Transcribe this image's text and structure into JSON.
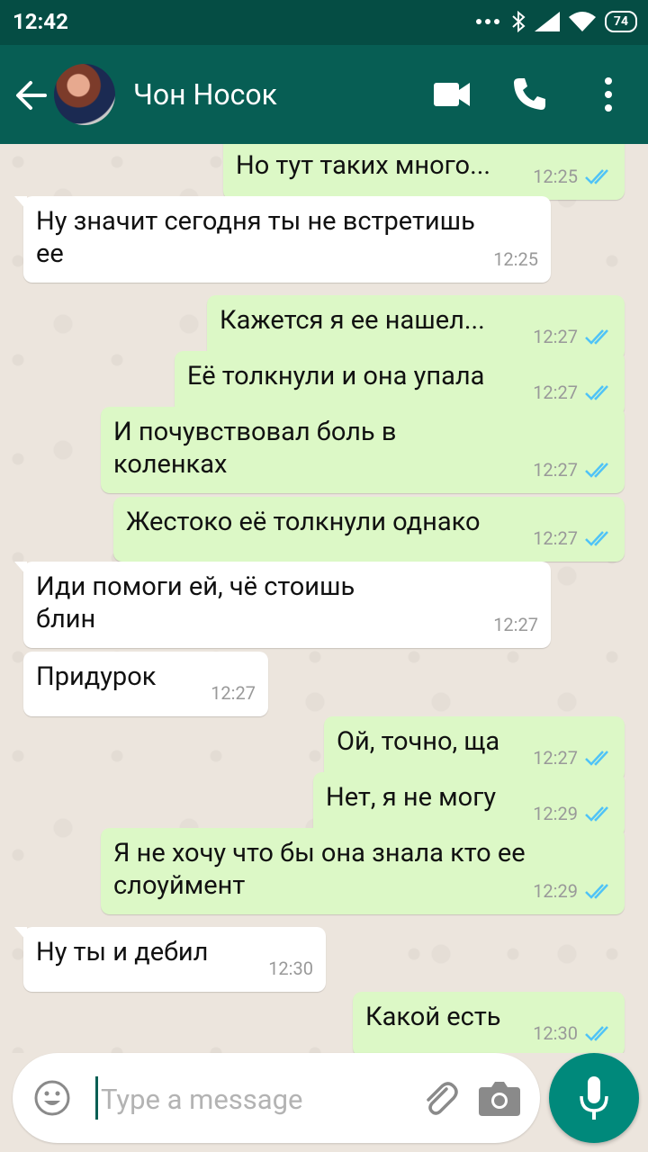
{
  "status": {
    "time": "12:42",
    "battery": "74"
  },
  "header": {
    "contact_name": "Чон Носок"
  },
  "messages": [
    {
      "dir": "out",
      "text": "Но тут таких много...",
      "time": "12:25"
    },
    {
      "dir": "in",
      "text": "Ну значит сегодня ты не встретишь ее",
      "time": "12:25"
    },
    {
      "dir": "out",
      "text": "Кажется я ее нашел...",
      "time": "12:27"
    },
    {
      "dir": "out",
      "text": "Её толкнули и она упала",
      "time": "12:27"
    },
    {
      "dir": "out",
      "text": "И почувствовал боль в коленках",
      "time": "12:27"
    },
    {
      "dir": "out",
      "text": "Жестоко её толкнули однако",
      "time": "12:27"
    },
    {
      "dir": "in",
      "text": "Иди помоги ей, чё стоишь блин",
      "time": "12:27"
    },
    {
      "dir": "in",
      "text": "Придурок",
      "time": "12:27"
    },
    {
      "dir": "out",
      "text": "Ой, точно, ща",
      "time": "12:27"
    },
    {
      "dir": "out",
      "text": "Нет, я не могу",
      "time": "12:29"
    },
    {
      "dir": "out",
      "text": "Я не хочу что бы она знала кто ее слоуймент",
      "time": "12:29"
    },
    {
      "dir": "in",
      "text": "Ну ты и дебил",
      "time": "12:30"
    },
    {
      "dir": "out",
      "text": "Какой есть",
      "time": "12:30"
    }
  ],
  "composer": {
    "placeholder": "Type a message"
  },
  "colors": {
    "header": "#075e54",
    "status_bar": "#054d44",
    "outgoing": "#dcf8c6",
    "incoming": "#ffffff",
    "read_ticks": "#4fc3f7",
    "mic": "#00897b"
  },
  "icons": [
    "back-arrow-icon",
    "video-call-icon",
    "phone-icon",
    "more-vert-icon",
    "emoji-icon",
    "attach-icon",
    "camera-icon",
    "mic-icon",
    "double-check-icon"
  ]
}
